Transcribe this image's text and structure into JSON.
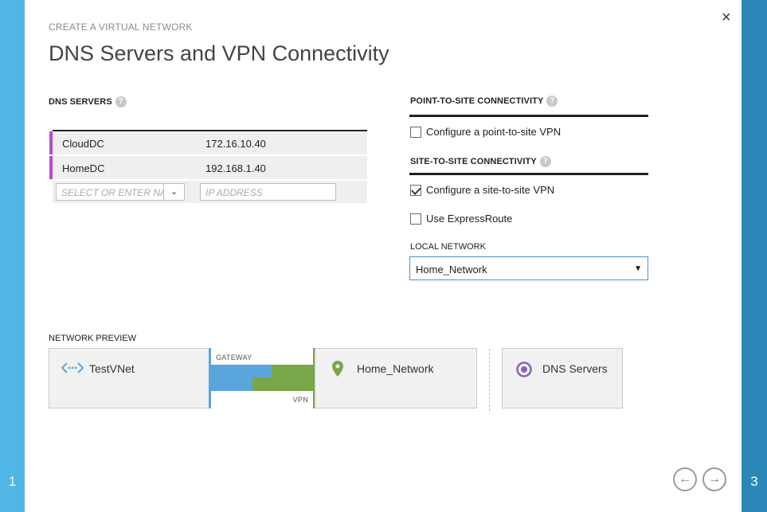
{
  "wizard": {
    "step_left": "1",
    "step_right": "3",
    "close_glyph": "×",
    "step_label": "CREATE A VIRTUAL NETWORK",
    "title": "DNS Servers and VPN Connectivity"
  },
  "dns": {
    "heading": "DNS SERVERS",
    "help": "?",
    "rows": [
      {
        "name": "CloudDC",
        "ip": "172.16.10.40"
      },
      {
        "name": "HomeDC",
        "ip": "192.168.1.40"
      }
    ],
    "name_placeholder": "SELECT OR ENTER NAME",
    "ip_placeholder": "IP ADDRESS",
    "dropdown_glyph": "⌄",
    "accent": "#b64fc8"
  },
  "p2s": {
    "heading": "POINT-TO-SITE CONNECTIVITY",
    "help": "?",
    "configure_label": "Configure a point-to-site VPN",
    "configure_checked": false
  },
  "s2s": {
    "heading": "SITE-TO-SITE CONNECTIVITY",
    "help": "?",
    "configure_label": "Configure a site-to-site VPN",
    "configure_checked": true,
    "expressroute_label": "Use ExpressRoute",
    "expressroute_checked": false,
    "local_network_label": "LOCAL NETWORK",
    "local_network_value": "Home_Network",
    "caret": "▼"
  },
  "preview": {
    "heading": "NETWORK PREVIEW",
    "vnet_name": "TestVNet",
    "gateway_label": "GATEWAY",
    "vpn_label": "VPN",
    "local_name": "Home_Network",
    "dns_label": "DNS Servers",
    "colors": {
      "vnet": "#5aa6dc",
      "local": "#7aa64a",
      "dns": "#8a63b5"
    }
  },
  "nav": {
    "back_glyph": "←",
    "next_glyph": "→"
  },
  "colors": {
    "left_rail": "#4fb6e6",
    "right_rail": "#2a87b7",
    "select_border": "#4a90c8"
  }
}
